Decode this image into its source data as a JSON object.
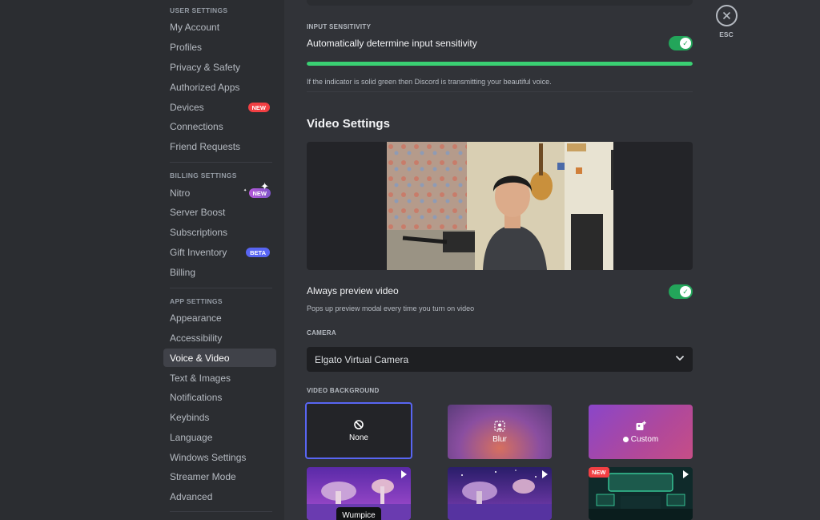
{
  "sidebar": {
    "user_settings_header": "USER SETTINGS",
    "user_items": [
      {
        "label": "My Account"
      },
      {
        "label": "Profiles"
      },
      {
        "label": "Privacy & Safety"
      },
      {
        "label": "Authorized Apps"
      },
      {
        "label": "Devices",
        "badge": "NEW"
      },
      {
        "label": "Connections"
      },
      {
        "label": "Friend Requests"
      }
    ],
    "billing_settings_header": "BILLING SETTINGS",
    "billing_items": [
      {
        "label": "Nitro",
        "badge": "NEW"
      },
      {
        "label": "Server Boost"
      },
      {
        "label": "Subscriptions"
      },
      {
        "label": "Gift Inventory",
        "badge": "BETA"
      },
      {
        "label": "Billing"
      }
    ],
    "app_settings_header": "APP SETTINGS",
    "app_items": [
      {
        "label": "Appearance"
      },
      {
        "label": "Accessibility"
      },
      {
        "label": "Voice & Video",
        "active": true
      },
      {
        "label": "Text & Images"
      },
      {
        "label": "Notifications"
      },
      {
        "label": "Keybinds"
      },
      {
        "label": "Language"
      },
      {
        "label": "Windows Settings"
      },
      {
        "label": "Streamer Mode"
      },
      {
        "label": "Advanced"
      }
    ]
  },
  "input_sensitivity": {
    "header": "INPUT SENSITIVITY",
    "toggle_label": "Automatically determine input sensitivity",
    "toggle_on": true,
    "level": 1.0,
    "description": "If the indicator is solid green then Discord is transmitting your beautiful voice."
  },
  "video_settings": {
    "title": "Video Settings",
    "always_preview_label": "Always preview video",
    "always_preview_desc": "Pops up preview modal every time you turn on video",
    "always_preview_on": true,
    "camera_header": "CAMERA",
    "camera_value": "Elgato Virtual Camera",
    "video_background_header": "VIDEO BACKGROUND",
    "backgrounds": [
      {
        "label": "None",
        "icon": "block-icon"
      },
      {
        "label": "Blur",
        "icon": "blur-person-icon"
      },
      {
        "label": "Custom",
        "icon": "add-image-icon"
      }
    ],
    "scenes": [
      {
        "label": "Wumpice"
      },
      {
        "label": ""
      },
      {
        "label": "",
        "badge": "NEW"
      }
    ],
    "hover_tooltip": "Wumpice"
  },
  "esc": {
    "label": "ESC"
  },
  "colors": {
    "accent_green": "#23a55a",
    "blurple": "#5865f2",
    "badge_red": "#f23f43"
  }
}
